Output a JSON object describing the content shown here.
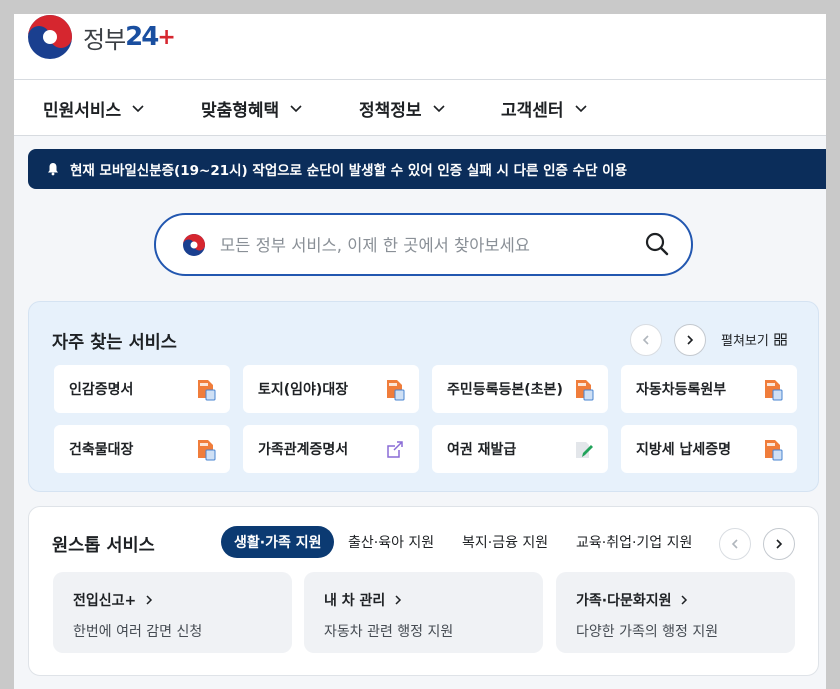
{
  "brand": {
    "wordmark": "정부",
    "num": "24",
    "plus": "+"
  },
  "gnb": [
    {
      "label": "민원서비스"
    },
    {
      "label": "맞춤형혜택"
    },
    {
      "label": "정책정보"
    },
    {
      "label": "고객센터"
    }
  ],
  "notice": {
    "text": "현재 모바일신분증(19~21시) 작업으로 순단이 발생할 수 있어 인증 실패 시 다른 인증 수단 이용"
  },
  "search": {
    "placeholder": "모든 정부 서비스, 이제 한 곳에서 찾아보세요",
    "value": ""
  },
  "frequent": {
    "title": "자주 찾는 서비스",
    "expand_label": "펼쳐보기",
    "items": [
      {
        "label": "인감증명서",
        "icon": "pdf-doc-icon"
      },
      {
        "label": "토지(임야)대장",
        "icon": "pdf-doc-icon"
      },
      {
        "label": "주민등록등본(초본)",
        "icon": "pdf-doc-icon"
      },
      {
        "label": "자동차등록원부",
        "icon": "pdf-doc-icon"
      },
      {
        "label": "건축물대장",
        "icon": "pdf-doc-icon"
      },
      {
        "label": "가족관계증명서",
        "icon": "external-link-icon"
      },
      {
        "label": "여권 재발급",
        "icon": "edit-doc-icon"
      },
      {
        "label": "지방세 납세증명",
        "icon": "pdf-doc-icon"
      }
    ]
  },
  "onestop": {
    "title": "원스톱 서비스",
    "tabs": [
      {
        "label": "생활·가족 지원",
        "active": true
      },
      {
        "label": "출산·육아 지원",
        "active": false
      },
      {
        "label": "복지·금융 지원",
        "active": false
      },
      {
        "label": "교육·취업·기업 지원",
        "active": false
      }
    ],
    "cards": [
      {
        "title": "전입신고+",
        "desc": "한번에 여러 감면 신청"
      },
      {
        "title": "내 차 관리",
        "desc": "자동차 관련 행정 지원"
      },
      {
        "title": "가족·다문화지원",
        "desc": "다양한 가족의 행정 지원"
      }
    ]
  },
  "colors": {
    "navy": "#0b2d5a",
    "accent_blue": "#2257b0",
    "tab_active": "#0b3a72",
    "brand_red": "#d6262f"
  }
}
